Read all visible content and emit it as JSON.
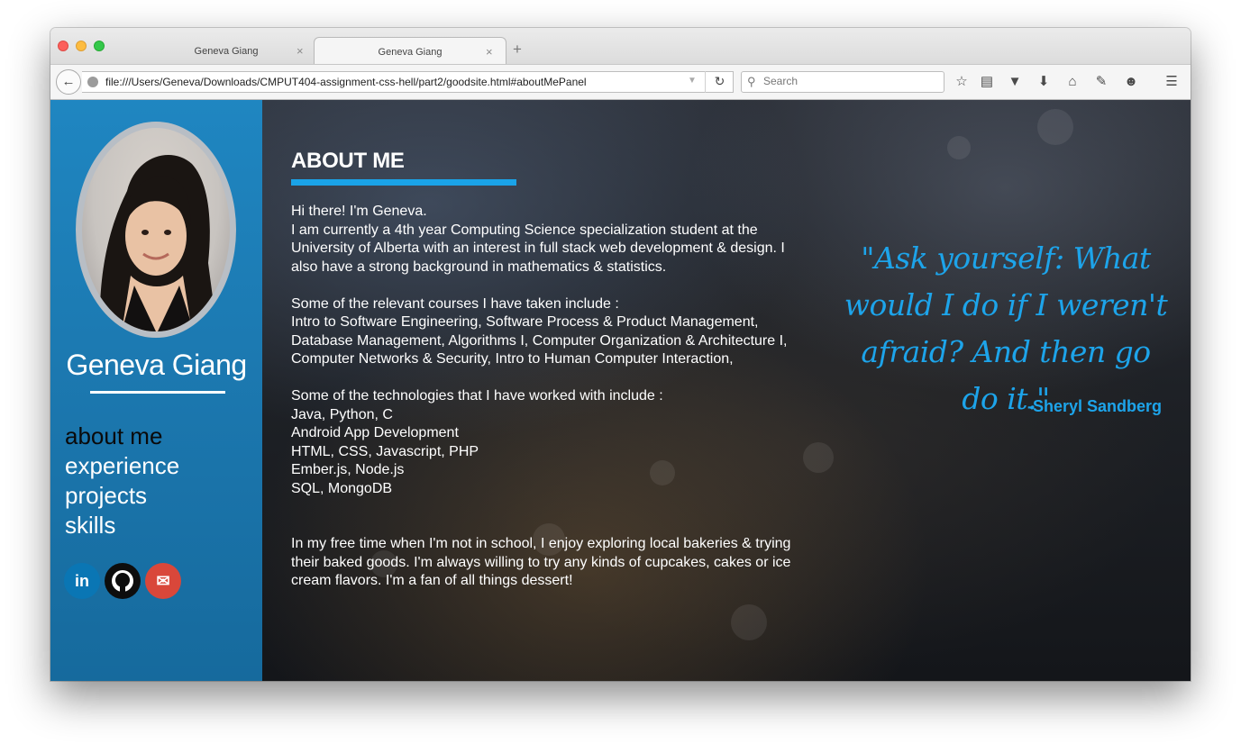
{
  "browser": {
    "tabs": [
      {
        "label": "Geneva Giang"
      },
      {
        "label": "Geneva Giang"
      }
    ],
    "new_tab_symbol": "+",
    "close_tab_symbol": "×",
    "url": "file:///Users/Geneva/Downloads/CMPUT404-assignment-css-hell/part2/goodsite.html#aboutMePanel",
    "search_placeholder": "Search",
    "toolbar_icons": [
      "star-icon",
      "reading-list-icon",
      "pocket-icon",
      "download-icon",
      "home-icon",
      "screenshot-icon",
      "smiley-icon",
      "menu-icon"
    ]
  },
  "sidebar": {
    "name": "Geneva Giang",
    "nav": [
      {
        "label": "about me",
        "active": true
      },
      {
        "label": "experience",
        "active": false
      },
      {
        "label": "projects",
        "active": false
      },
      {
        "label": "skills",
        "active": false
      }
    ],
    "social": [
      {
        "icon": "linkedin-icon",
        "glyph": "in",
        "color": "#0a76b4"
      },
      {
        "icon": "github-icon",
        "glyph": "●",
        "color": "#0d0d0d"
      },
      {
        "icon": "email-icon",
        "glyph": "✉",
        "color": "#d9473a"
      }
    ],
    "background_color": "#1b76ad"
  },
  "about": {
    "heading": "ABOUT ME",
    "intro_line1": "Hi there! I'm Geneva.",
    "intro_line2": "I am currently a 4th year Computing Science specialization student at the University of Alberta with an interest in full stack web development & design. I also have a strong background in mathematics & statistics.",
    "courses_heading": "Some of the relevant courses I have taken include :",
    "courses_list": "Intro to Software Engineering, Software Process & Product Management, Database Management, Algorithms I, Computer Organization & Architecture I, Computer Networks & Security, Intro to Human Computer Interaction,",
    "tech_heading": "Some of the technologies that I have worked with include :",
    "tech_items": [
      "Java, Python, C",
      "Android App Development",
      "HTML, CSS, Javascript, PHP",
      "Ember.js, Node.js",
      "SQL, MongoDB"
    ],
    "free_time": "In my free time when I'm not in school, I enjoy exploring local bakeries & trying their baked goods. I'm always willing to try any kinds of cupcakes, cakes or ice cream flavors. I'm a fan of all things dessert!",
    "accent_color": "#1aa3e8"
  },
  "quote": {
    "text": "\"Ask yourself: What would I do if I weren't afraid? And then go do it.\"",
    "author": "-Sheryl Sandberg",
    "color": "#1da4ea"
  }
}
